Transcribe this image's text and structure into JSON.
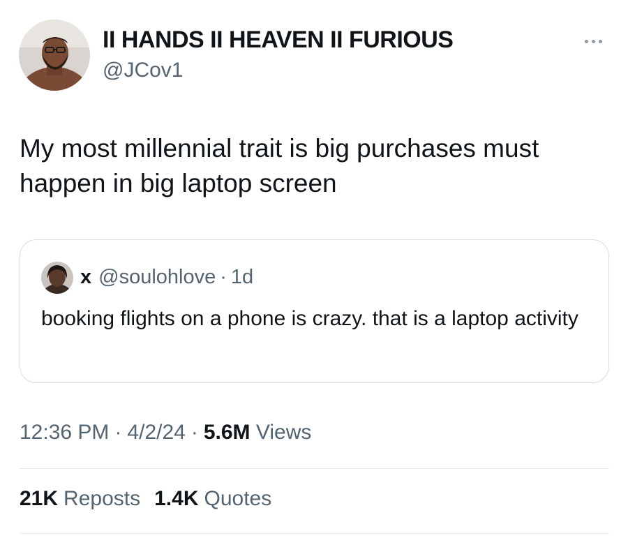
{
  "author": {
    "display_name": "II HANDS II HEAVEN II FURIOUS",
    "handle": "@JCov1",
    "avatar_icon": "profile-photo-icon"
  },
  "more_icon": "more-horizontal-icon",
  "tweet": {
    "text": "My most millennial trait is big purchases must happen in big laptop screen"
  },
  "quoted": {
    "display_name": "x",
    "handle": "@soulohlove",
    "separator": "·",
    "time": "1d",
    "text": "booking flights on a phone is crazy. that is a laptop activity",
    "avatar_icon": "profile-photo-icon"
  },
  "meta": {
    "time": "12:36 PM",
    "sep1": "·",
    "date": "4/2/24",
    "sep2": "·",
    "views_count": "5.6M",
    "views_label": "Views"
  },
  "stats": {
    "reposts_count": "21K",
    "reposts_label": "Reposts",
    "quotes_count": "1.4K",
    "quotes_label": "Quotes"
  },
  "colors": {
    "text_primary": "#0f1419",
    "text_secondary": "#536471",
    "border": "#d8dee3"
  }
}
